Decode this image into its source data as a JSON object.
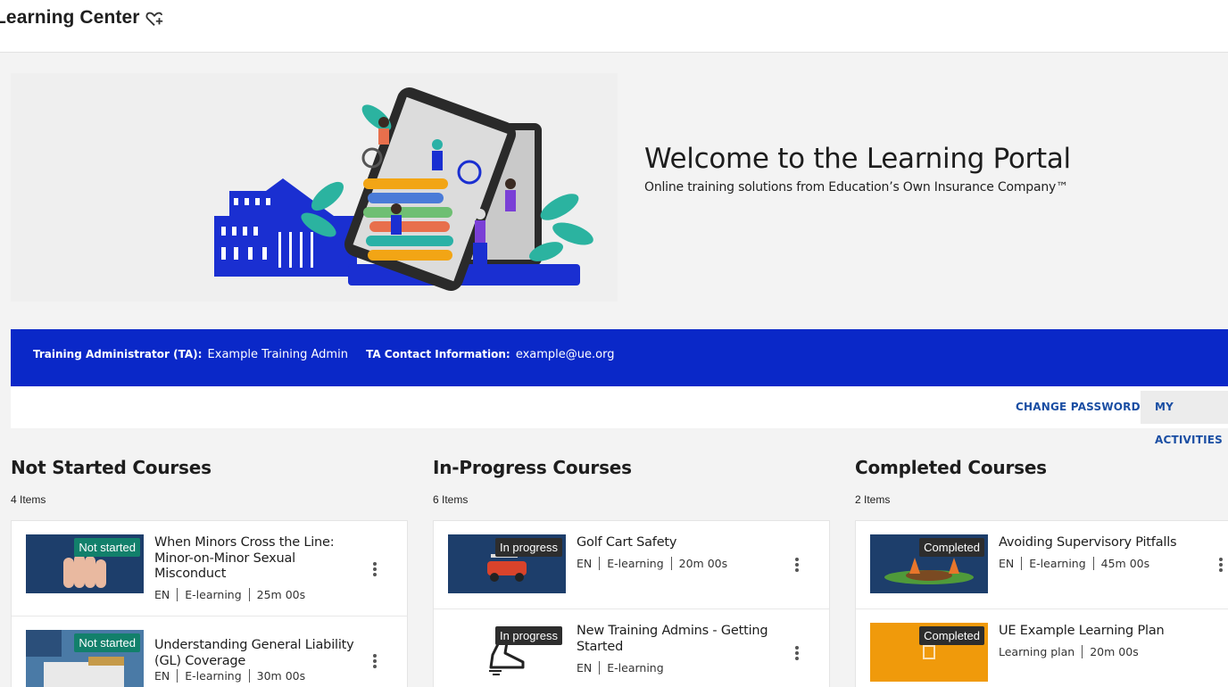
{
  "header": {
    "title": "Learning Center",
    "favorite_icon": "heart-plus-icon"
  },
  "hero": {
    "title": "Welcome to the Learning Portal",
    "subtitle": "Online training solutions from Education’s Own Insurance Company™"
  },
  "ta_bar": {
    "admin_label": "Training Administrator (TA):",
    "admin_value": "Example Training Admin",
    "contact_label": "TA Contact Information:",
    "contact_value": "example@ue.org",
    "color": "#0a28c8"
  },
  "actions": {
    "change_password": "CHANGE PASSWORD",
    "my_activities": "MY ACTIVITIES"
  },
  "columns": [
    {
      "title": "Not Started Courses",
      "count": "4 Items",
      "cards": [
        {
          "badge": "Not started",
          "title": "When Minors Cross the Line: Minor-on-Minor Sexual Misconduct",
          "lang": "EN",
          "type": "E-learning",
          "duration": "25m 00s"
        },
        {
          "badge": "Not started",
          "title": "Understanding General Liability (GL) Coverage",
          "lang": "EN",
          "type": "E-learning",
          "duration": "30m 00s"
        }
      ]
    },
    {
      "title": "In-Progress Courses",
      "count": "6 Items",
      "cards": [
        {
          "badge": "In progress",
          "title": "Golf Cart Safety",
          "lang": "EN",
          "type": "E-learning",
          "duration": "20m 00s"
        },
        {
          "badge": "In progress",
          "title": "New Training Admins - Getting Started",
          "lang": "EN",
          "type": "E-learning",
          "duration": ""
        }
      ]
    },
    {
      "title": "Completed Courses",
      "count": "2 Items",
      "cards": [
        {
          "badge": "Completed",
          "title": "Avoiding Supervisory Pitfalls",
          "lang": "EN",
          "type": "E-learning",
          "duration": "45m 00s"
        },
        {
          "badge": "Completed",
          "title": "UE Example Learning Plan",
          "lang": "",
          "type": "Learning plan",
          "duration": "20m 00s"
        }
      ]
    }
  ],
  "colors": {
    "accent_link": "#1a4ea3",
    "not_started_badge": "#12806b",
    "status_badge": "#2d2d2d"
  }
}
